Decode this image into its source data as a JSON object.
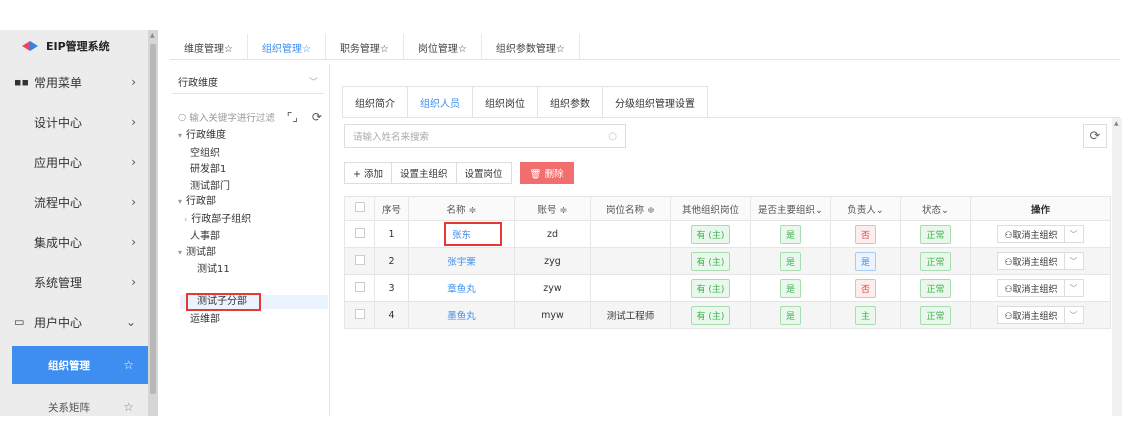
{
  "colors": {
    "accent": "#3d8ef0",
    "danger": "#f26d6d",
    "highlight_box": "#e53935"
  },
  "sidebar": {
    "brand": "EIP管理系统",
    "items": [
      {
        "label": "常用菜单",
        "icon": "grid-icon",
        "chevron": "›"
      },
      {
        "label": "设计中心",
        "chevron": "›"
      },
      {
        "label": "应用中心",
        "chevron": "›"
      },
      {
        "label": "流程中心",
        "chevron": "›"
      },
      {
        "label": "集成中心",
        "chevron": "›"
      },
      {
        "label": "系统管理",
        "chevron": "›"
      },
      {
        "label": "用户中心",
        "icon": "monitor-icon",
        "chevron": "⌄"
      }
    ],
    "subitems": [
      {
        "label": "组织管理",
        "active": true
      },
      {
        "label": "关系矩阵",
        "active": false
      }
    ]
  },
  "tabs": [
    "维度管理☆",
    "组织管理☆",
    "职务管理☆",
    "岗位管理☆",
    "组织参数管理☆"
  ],
  "tree": {
    "dimension": "行政维度",
    "search_placeholder": "输入关键字进行过滤",
    "nodes": [
      {
        "label": "行政维度",
        "toggle": "▾"
      },
      {
        "label": "空组织"
      },
      {
        "label": "研发部1"
      },
      {
        "label": "测试部门"
      },
      {
        "label": "行政部",
        "toggle": "▾"
      },
      {
        "label": "行政部子组织",
        "toggle": "›"
      },
      {
        "label": "人事部"
      },
      {
        "label": "测试部",
        "toggle": "▾"
      },
      {
        "label": "测试11"
      },
      {
        "label": "测试子分部"
      },
      {
        "label": "运维部"
      }
    ]
  },
  "subtabs": [
    "组织简介",
    "组织人员",
    "组织岗位",
    "组织参数",
    "分级组织管理设置"
  ],
  "search": {
    "placeholder": "请输入姓名来搜索"
  },
  "toolbar": {
    "add": "+ 添加",
    "set_main_org": "设置主组织",
    "set_post": "设置岗位",
    "delete": "🗑 删除"
  },
  "table": {
    "headers": [
      "序号",
      "名称 ≑",
      "账号 ≑",
      "岗位名称 ≑",
      "其他组织岗位",
      "是否主要组织⌄",
      "负责人⌄",
      "状态⌄",
      "操作"
    ],
    "rows": [
      {
        "no": "1",
        "name": "张东",
        "account": "zd",
        "post": "",
        "other": "有 (主)",
        "is_main": "是",
        "head": "否",
        "status": "正常",
        "action": "⚇取消主组织"
      },
      {
        "no": "2",
        "name": "张宇栗",
        "account": "zyg",
        "post": "",
        "other": "有 (主)",
        "is_main": "是",
        "head": "是",
        "status": "正常",
        "action": "⚇取消主组织"
      },
      {
        "no": "3",
        "name": "章鱼丸",
        "account": "zyw",
        "post": "",
        "other": "有 (主)",
        "is_main": "是",
        "head": "否",
        "status": "正常",
        "action": "⚇取消主组织"
      },
      {
        "no": "4",
        "name": "墨鱼丸",
        "account": "myw",
        "post": "测试工程师",
        "other": "有 (主)",
        "is_main": "是",
        "head": "主",
        "status": "正常",
        "action": "⚇取消主组织"
      }
    ]
  }
}
